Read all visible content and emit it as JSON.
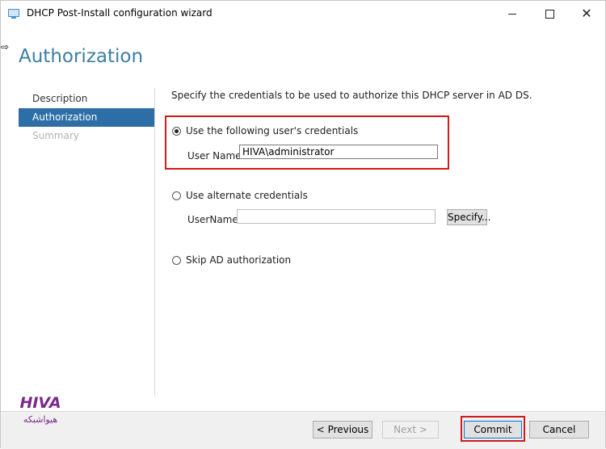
{
  "window": {
    "title": "DHCP Post-Install configuration wizard"
  },
  "page": {
    "header": "Authorization",
    "intro": "Specify the credentials to be used to authorize this DHCP server in AD DS."
  },
  "nav": {
    "items": [
      {
        "label": "Description",
        "state": "normal"
      },
      {
        "label": "Authorization",
        "state": "selected"
      },
      {
        "label": "Summary",
        "state": "disabled"
      }
    ]
  },
  "options": {
    "use_current": {
      "label": "Use the following user's credentials",
      "checked": true,
      "username_label": "User Name:",
      "username_value": "HIVA\\administrator"
    },
    "alternate": {
      "label": "Use alternate credentials",
      "checked": false,
      "username_label": "UserName:",
      "username_value": "",
      "specify_button": "Specify..."
    },
    "skip": {
      "label": "Skip AD authorization",
      "checked": false
    }
  },
  "footer": {
    "previous": "< Previous",
    "next": "Next >",
    "commit": "Commit",
    "cancel": "Cancel"
  },
  "colors": {
    "accent": "#2e6ea6",
    "header_text": "#3c7ea3",
    "highlight": "#d11a1a"
  },
  "logo": {
    "text_latin": "HIVA",
    "text_persian": "هیواشبکه"
  }
}
